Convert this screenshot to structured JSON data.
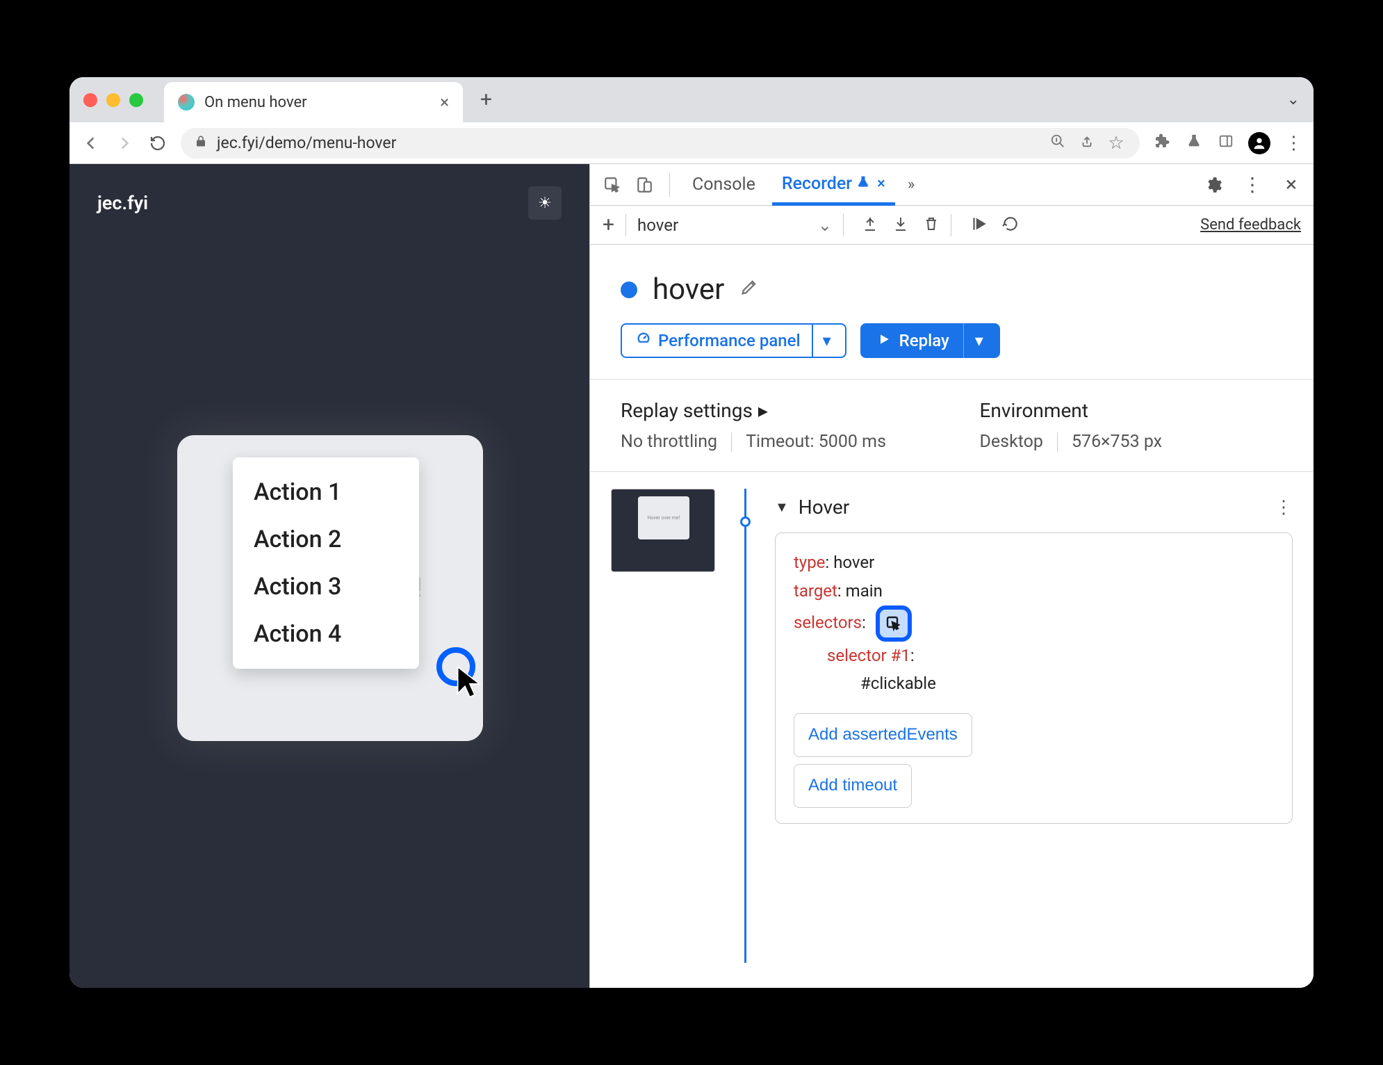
{
  "browser": {
    "tab_title": "On menu hover",
    "url": "jec.fyi/demo/menu-hover",
    "nav": {
      "back": "←",
      "forward": "→",
      "reload": "↻"
    }
  },
  "page": {
    "brand": "jec.fyi",
    "card_hint": "Hover over me!",
    "menu_items": [
      "Action 1",
      "Action 2",
      "Action 3",
      "Action 4"
    ]
  },
  "devtools": {
    "tabs": {
      "console": "Console",
      "recorder": "Recorder"
    },
    "recorder": {
      "recording_name": "hover",
      "title": "hover",
      "perf_button": "Performance panel",
      "replay_button": "Replay",
      "send_feedback": "Send feedback",
      "replay_settings": {
        "label": "Replay settings",
        "throttling": "No throttling",
        "timeout": "Timeout: 5000 ms"
      },
      "environment": {
        "label": "Environment",
        "device": "Desktop",
        "viewport": "576×753 px"
      },
      "step": {
        "name": "Hover",
        "type_key": "type",
        "type_val": "hover",
        "target_key": "target",
        "target_val": "main",
        "selectors_key": "selectors",
        "selector_label": "selector #1",
        "selector_val": "#clickable",
        "add_asserted": "Add assertedEvents",
        "add_timeout": "Add timeout"
      },
      "thumb_text": "Hover over me!"
    }
  }
}
